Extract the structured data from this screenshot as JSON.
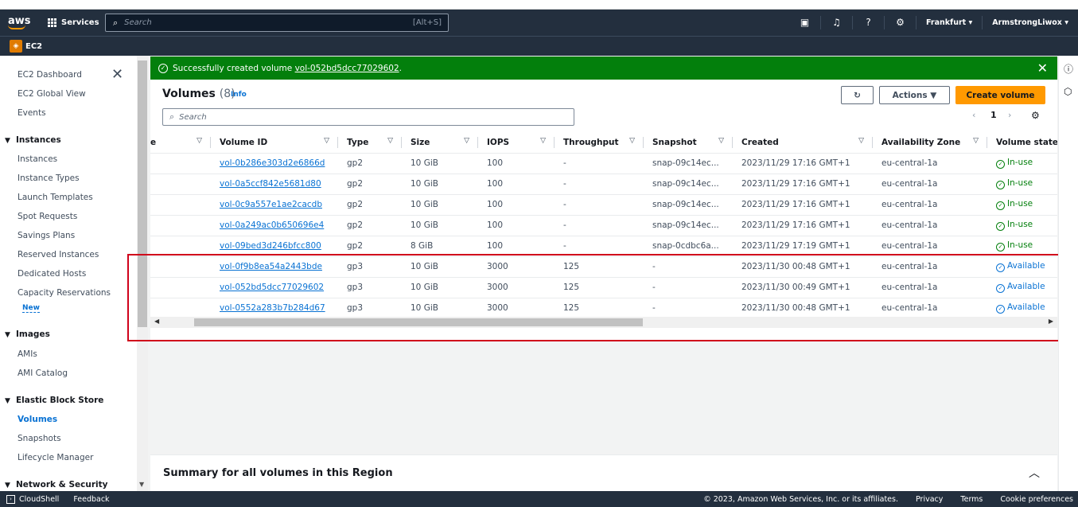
{
  "topnav": {
    "logo": "aws",
    "services": "Services",
    "search_placeholder": "Search",
    "search_shortcut": "[Alt+S]",
    "region": "Frankfurt ▾",
    "user": "ArmstrongLiwox ▾"
  },
  "subnav": {
    "service": "EC2"
  },
  "sidebar": {
    "dashboard": "EC2 Dashboard",
    "global_view": "EC2 Global View",
    "events": "Events",
    "instances_section": "Instances",
    "instances": "Instances",
    "instance_types": "Instance Types",
    "launch_templates": "Launch Templates",
    "spot_requests": "Spot Requests",
    "savings_plans": "Savings Plans",
    "reserved_instances": "Reserved Instances",
    "dedicated_hosts": "Dedicated Hosts",
    "capacity_reservations": "Capacity Reservations",
    "new_badge": "New",
    "images_section": "Images",
    "amis": "AMIs",
    "ami_catalog": "AMI Catalog",
    "ebs_section": "Elastic Block Store",
    "volumes": "Volumes",
    "snapshots": "Snapshots",
    "lifecycle_manager": "Lifecycle Manager",
    "network_section": "Network & Security"
  },
  "flash": {
    "prefix": "Successfully created volume ",
    "volume_link": "vol-052bd5dcc77029602",
    "suffix": "."
  },
  "volumes": {
    "title": "Volumes",
    "count": "(8)",
    "info": "Info",
    "actions": "Actions ▼",
    "create": "Create volume",
    "search_placeholder": "Search",
    "page": "1",
    "columns": [
      "e",
      "Volume ID",
      "Type",
      "Size",
      "IOPS",
      "Throughput",
      "Snapshot",
      "Created",
      "Availability Zone",
      "Volume state"
    ],
    "rows": [
      {
        "id": "vol-0b286e303d2e6866d",
        "type": "gp2",
        "size": "10 GiB",
        "iops": "100",
        "throughput": "-",
        "snapshot": "snap-09c14ec...",
        "created": "2023/11/29 17:16 GMT+1",
        "az": "eu-central-1a",
        "state": "In-use"
      },
      {
        "id": "vol-0a5ccf842e5681d80",
        "type": "gp2",
        "size": "10 GiB",
        "iops": "100",
        "throughput": "-",
        "snapshot": "snap-09c14ec...",
        "created": "2023/11/29 17:16 GMT+1",
        "az": "eu-central-1a",
        "state": "In-use"
      },
      {
        "id": "vol-0c9a557e1ae2cacdb",
        "type": "gp2",
        "size": "10 GiB",
        "iops": "100",
        "throughput": "-",
        "snapshot": "snap-09c14ec...",
        "created": "2023/11/29 17:16 GMT+1",
        "az": "eu-central-1a",
        "state": "In-use"
      },
      {
        "id": "vol-0a249ac0b650696e4",
        "type": "gp2",
        "size": "10 GiB",
        "iops": "100",
        "throughput": "-",
        "snapshot": "snap-09c14ec...",
        "created": "2023/11/29 17:16 GMT+1",
        "az": "eu-central-1a",
        "state": "In-use"
      },
      {
        "id": "vol-09bed3d246bfcc800",
        "type": "gp2",
        "size": "8 GiB",
        "iops": "100",
        "throughput": "-",
        "snapshot": "snap-0cdbc6a...",
        "created": "2023/11/29 17:19 GMT+1",
        "az": "eu-central-1a",
        "state": "In-use"
      },
      {
        "id": "vol-0f9b8ea54a2443bde",
        "type": "gp3",
        "size": "10 GiB",
        "iops": "3000",
        "throughput": "125",
        "snapshot": "-",
        "created": "2023/11/30 00:48 GMT+1",
        "az": "eu-central-1a",
        "state": "Available"
      },
      {
        "id": "vol-052bd5dcc77029602",
        "type": "gp3",
        "size": "10 GiB",
        "iops": "3000",
        "throughput": "125",
        "snapshot": "-",
        "created": "2023/11/30 00:49 GMT+1",
        "az": "eu-central-1a",
        "state": "Available"
      },
      {
        "id": "vol-0552a283b7b284d67",
        "type": "gp3",
        "size": "10 GiB",
        "iops": "3000",
        "throughput": "125",
        "snapshot": "-",
        "created": "2023/11/30 00:48 GMT+1",
        "az": "eu-central-1a",
        "state": "Available"
      }
    ]
  },
  "summary": {
    "title": "Summary for all volumes in this Region"
  },
  "footer": {
    "cloudshell": "CloudShell",
    "feedback": "Feedback",
    "copyright": "© 2023, Amazon Web Services, Inc. or its affiliates.",
    "privacy": "Privacy",
    "terms": "Terms",
    "cookies": "Cookie preferences"
  },
  "colors": {
    "nav": "#232f3e",
    "accent": "#ff9900",
    "success": "#037f0c",
    "link": "#0972d3",
    "highlight": "#d0021b"
  }
}
